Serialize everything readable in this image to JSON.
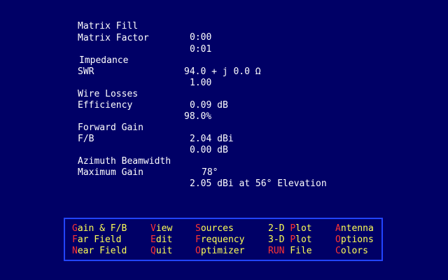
{
  "results": [
    {
      "id": "matrix-fill",
      "label": "Matrix Fill",
      "value": "0:00"
    },
    {
      "id": "matrix-factor",
      "label": "Matrix Factor",
      "value": "0:01"
    },
    {
      "id": "impedance",
      "label": "Impedance",
      "value": "94.0 + j 0.0 Ω"
    },
    {
      "id": "swr",
      "label": "SWR",
      "value": "1.00"
    },
    {
      "id": "wire-losses",
      "label": "Wire Losses",
      "value": "0.09 dB"
    },
    {
      "id": "efficiency",
      "label": "Efficiency",
      "value": "98.0%"
    },
    {
      "id": "forward-gain",
      "label": "Forward Gain",
      "value": "2.04 dBi"
    },
    {
      "id": "front-back",
      "label": "F/B",
      "value": "0.00 dB"
    },
    {
      "id": "azimuth-beamwidth",
      "label": "Azimuth Beamwidth",
      "value": "78°"
    },
    {
      "id": "maximum-gain",
      "label": "Maximum Gain",
      "value": "2.05 dBi at 56° Elevation"
    }
  ],
  "menu": [
    {
      "id": "gain-fb",
      "hotkey": "G",
      "rest": "ain & F/B"
    },
    {
      "id": "far-field",
      "hotkey": "F",
      "rest": "ar Field"
    },
    {
      "id": "near-field",
      "hotkey": "N",
      "rest": "ear Field"
    },
    {
      "id": "view",
      "hotkey": "V",
      "rest": "iew"
    },
    {
      "id": "edit",
      "hotkey": "E",
      "rest": "dit"
    },
    {
      "id": "quit",
      "hotkey": "Q",
      "rest": "uit"
    },
    {
      "id": "sources",
      "hotkey": "S",
      "rest": "ources"
    },
    {
      "id": "frequency",
      "hotkey": "F",
      "rest": "requency"
    },
    {
      "id": "optimizer",
      "hotkey": "O",
      "rest": "ptimizer"
    },
    {
      "id": "2d-plot",
      "pre": "2-D ",
      "hotkey": "P",
      "rest": "lot"
    },
    {
      "id": "3d-plot",
      "pre": "3-D ",
      "hotkey": "P",
      "rest": "lot"
    },
    {
      "id": "run-file",
      "hotkey": "RUN",
      "rest": " File"
    },
    {
      "id": "antenna",
      "hotkey": "A",
      "rest": "ntenna"
    },
    {
      "id": "options",
      "hotkey": "O",
      "rest": "ptions"
    },
    {
      "id": "colors",
      "hotkey": "C",
      "rest": "olors"
    }
  ],
  "colors": {
    "background": "#000066",
    "text": "#ffffff",
    "menu_text": "#ffff55",
    "hotkey": "#ff3333",
    "menu_border": "#2244ff"
  }
}
